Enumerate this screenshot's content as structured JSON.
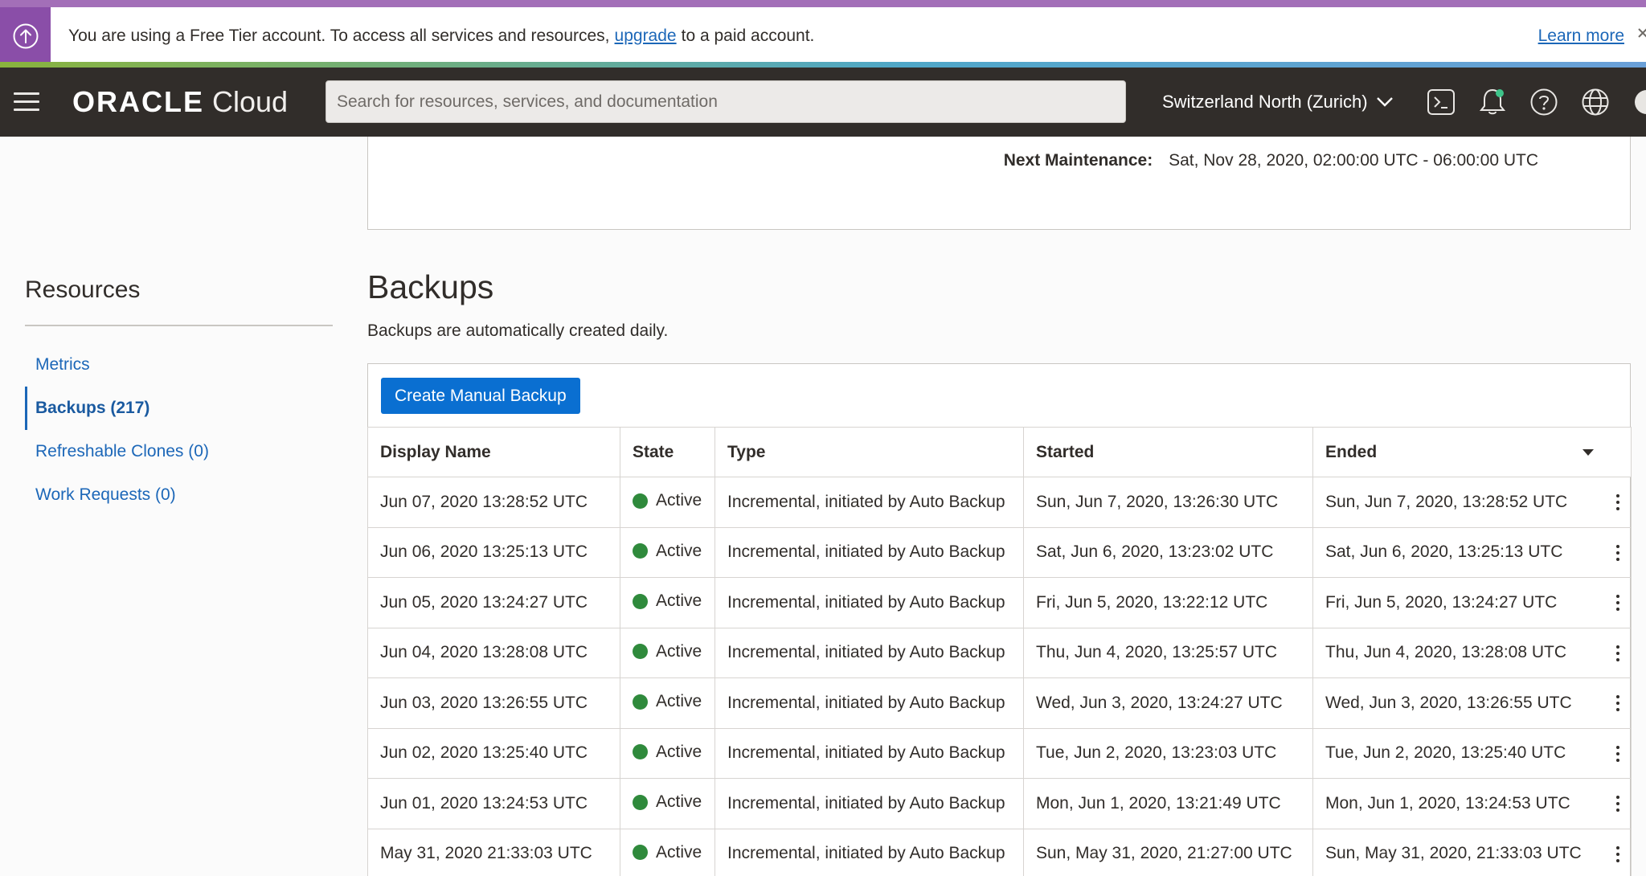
{
  "banner": {
    "text_before": "You are using a Free Tier account. To access all services and resources,",
    "link": "upgrade",
    "text_after": "to a paid account.",
    "learn_more": "Learn more",
    "icon": "upgrade-arrow-icon"
  },
  "nav": {
    "logo_oracle": "ORACLE",
    "logo_cloud": "Cloud",
    "search_placeholder": "Search for resources, services, and documentation",
    "region": "Switzerland North (Zurich)",
    "icons": [
      "cloud-shell-icon",
      "notifications-bell-icon",
      "help-icon",
      "language-globe-icon",
      "profile-icon"
    ]
  },
  "maintenance": {
    "label": "Next Maintenance:",
    "value": "Sat, Nov 28, 2020, 02:00:00 UTC - 06:00:00 UTC"
  },
  "resources": {
    "title": "Resources",
    "items": [
      {
        "label": "Metrics",
        "active": false
      },
      {
        "label": "Backups (217)",
        "active": true
      },
      {
        "label": "Refreshable Clones (0)",
        "active": false
      },
      {
        "label": "Work Requests (0)",
        "active": false
      }
    ]
  },
  "backups": {
    "title": "Backups",
    "description": "Backups are automatically created daily.",
    "create_button": "Create Manual Backup",
    "columns": [
      "Display Name",
      "State",
      "Type",
      "Started",
      "Ended"
    ],
    "rows": [
      {
        "name": "Jun 07, 2020 13:28:52 UTC",
        "state": "Active",
        "type": "Incremental, initiated by Auto Backup",
        "started": "Sun, Jun 7, 2020, 13:26:30 UTC",
        "ended": "Sun, Jun 7, 2020, 13:28:52 UTC"
      },
      {
        "name": "Jun 06, 2020 13:25:13 UTC",
        "state": "Active",
        "type": "Incremental, initiated by Auto Backup",
        "started": "Sat, Jun 6, 2020, 13:23:02 UTC",
        "ended": "Sat, Jun 6, 2020, 13:25:13 UTC"
      },
      {
        "name": "Jun 05, 2020 13:24:27 UTC",
        "state": "Active",
        "type": "Incremental, initiated by Auto Backup",
        "started": "Fri, Jun 5, 2020, 13:22:12 UTC",
        "ended": "Fri, Jun 5, 2020, 13:24:27 UTC"
      },
      {
        "name": "Jun 04, 2020 13:28:08 UTC",
        "state": "Active",
        "type": "Incremental, initiated by Auto Backup",
        "started": "Thu, Jun 4, 2020, 13:25:57 UTC",
        "ended": "Thu, Jun 4, 2020, 13:28:08 UTC"
      },
      {
        "name": "Jun 03, 2020 13:26:55 UTC",
        "state": "Active",
        "type": "Incremental, initiated by Auto Backup",
        "started": "Wed, Jun 3, 2020, 13:24:27 UTC",
        "ended": "Wed, Jun 3, 2020, 13:26:55 UTC"
      },
      {
        "name": "Jun 02, 2020 13:25:40 UTC",
        "state": "Active",
        "type": "Incremental, initiated by Auto Backup",
        "started": "Tue, Jun 2, 2020, 13:23:03 UTC",
        "ended": "Tue, Jun 2, 2020, 13:25:40 UTC"
      },
      {
        "name": "Jun 01, 2020 13:24:53 UTC",
        "state": "Active",
        "type": "Incremental, initiated by Auto Backup",
        "started": "Mon, Jun 1, 2020, 13:21:49 UTC",
        "ended": "Mon, Jun 1, 2020, 13:24:53 UTC"
      },
      {
        "name": "May 31, 2020 21:33:03 UTC",
        "state": "Active",
        "type": "Incremental, initiated by Auto Backup",
        "started": "Sun, May 31, 2020, 21:27:00 UTC",
        "ended": "Sun, May 31, 2020, 21:33:03 UTC"
      }
    ]
  },
  "colors": {
    "banner_accent": "#8a4ea8",
    "nav_bg": "#312d2a",
    "link": "#1c67b8",
    "primary_button": "#0a6fd1",
    "active_status": "#2f8a3c"
  }
}
